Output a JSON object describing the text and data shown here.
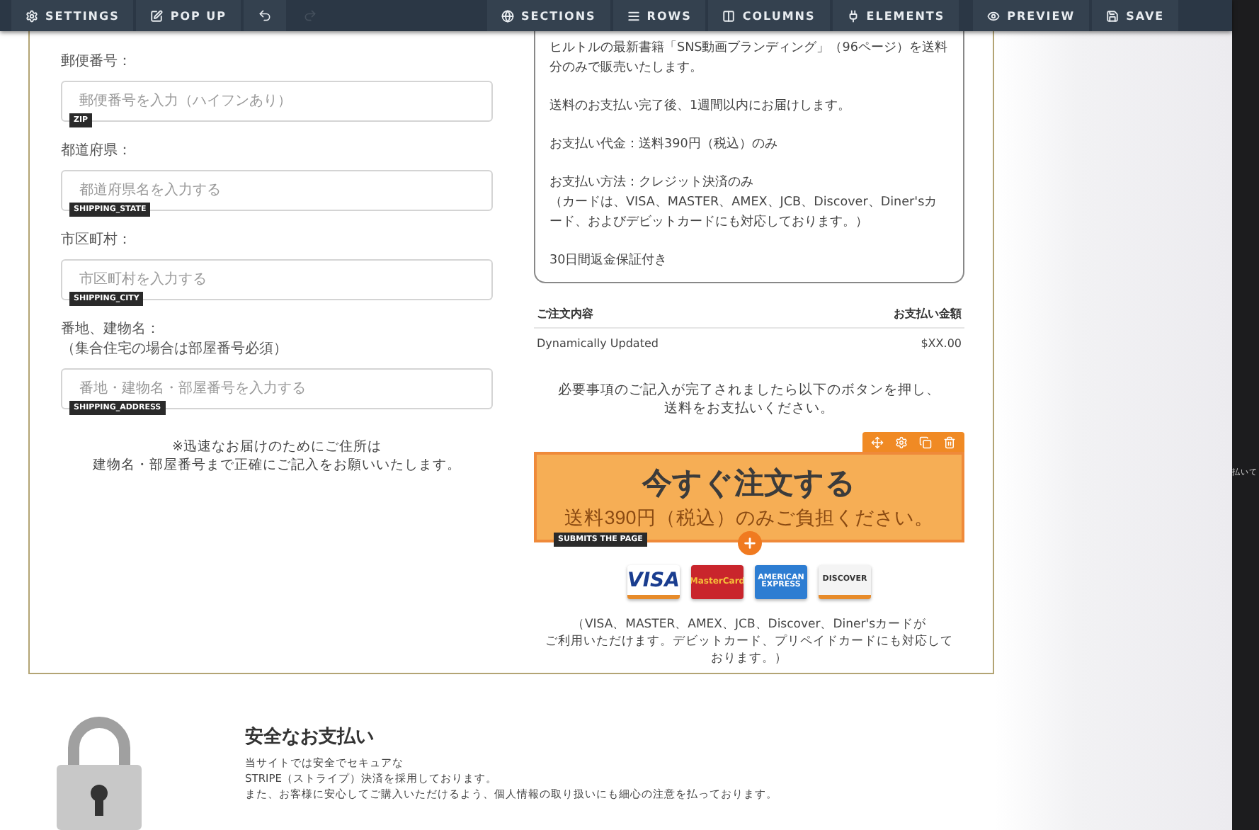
{
  "toolbar": {
    "left": [
      {
        "kind": "settings",
        "label": "SETTINGS"
      },
      {
        "kind": "popup",
        "label": "POP UP"
      }
    ],
    "history": [
      {
        "kind": "undo",
        "disabled": false
      },
      {
        "kind": "redo",
        "disabled": true
      }
    ],
    "right": [
      {
        "kind": "sections",
        "label": "SECTIONS"
      },
      {
        "kind": "rows",
        "label": "ROWS"
      },
      {
        "kind": "columns",
        "label": "COLUMNS"
      },
      {
        "kind": "elements",
        "label": "ELEMENTS"
      }
    ],
    "actions": [
      {
        "kind": "preview",
        "label": "PREVIEW"
      },
      {
        "kind": "save",
        "label": "SAVE"
      }
    ]
  },
  "form": {
    "fields": [
      {
        "label": "郵便番号：",
        "placeholder": "郵便番号を入力（ハイフンあり）",
        "tag": "ZIP"
      },
      {
        "label": "都道府県：",
        "placeholder": "都道府県名を入力する",
        "tag": "SHIPPING_STATE"
      },
      {
        "label": "市区町村：",
        "placeholder": "市区町村を入力する",
        "tag": "SHIPPING_CITY"
      },
      {
        "label": "番地、建物名：",
        "note": "（集合住宅の場合は部屋番号必須）",
        "placeholder": "番地・建物名・部屋番号を入力する",
        "tag": "SHIPPING_ADDRESS"
      }
    ],
    "address_note": [
      "※迅速なお届けのためにご住所は",
      "建物名・部屋番号まで正確にご記入をお願いいたします。"
    ]
  },
  "info_box": {
    "paragraphs": [
      [
        "ヒルトルの最新書籍「SNS動画ブランディング」（96ページ）を送料分のみで販売いたします。"
      ],
      [
        "送料のお支払い完了後、1週間以内にお届けします。"
      ],
      [
        "お支払い代金：送料390円（税込）のみ"
      ],
      [
        "お支払い方法：クレジット決済のみ",
        "（カードは、VISA、MASTER、AMEX、JCB、Discover、Diner'sカード、およびデビットカードにも対応しております。）"
      ],
      [
        "30日間返金保証付き"
      ]
    ]
  },
  "order_table": {
    "columns": [
      "ご注文内容",
      "お支払い金額"
    ],
    "rows": [
      [
        "Dynamically Updated",
        "$XX.00"
      ]
    ]
  },
  "instructions": [
    "必要事項のご記入が完了されましたら以下のボタンを押し、",
    "送料をお支払いください。"
  ],
  "order_button": {
    "title": "今すぐ注文する",
    "subtitle": "送料390円（税込）のみご負担ください。",
    "tag": "SUBMITS THE PAGE",
    "selected": true
  },
  "cards": [
    {
      "kind": "visa",
      "label": "VISA"
    },
    {
      "kind": "mastercard",
      "label": "MasterCard"
    },
    {
      "kind": "amex",
      "label": "AMERICAN EXPRESS"
    },
    {
      "kind": "discover",
      "label": "DISCOVER"
    }
  ],
  "card_note": [
    "（VISA、MASTER、AMEX、JCB、Discover、Diner'sカードが",
    "ご利用いただけます。デビットカード、プリペイドカードにも対応して",
    "おります。）"
  ],
  "secure": {
    "title": "安全なお支払い",
    "lines": [
      "当サイトでは安全でセキュアな",
      "STRIPE（ストライプ）決済を採用しております。",
      "また、お客様に安心してご購入いただけるよう、個人情報の取り扱いにも細心の注意を払っております。"
    ]
  },
  "side_text": "払いて"
}
